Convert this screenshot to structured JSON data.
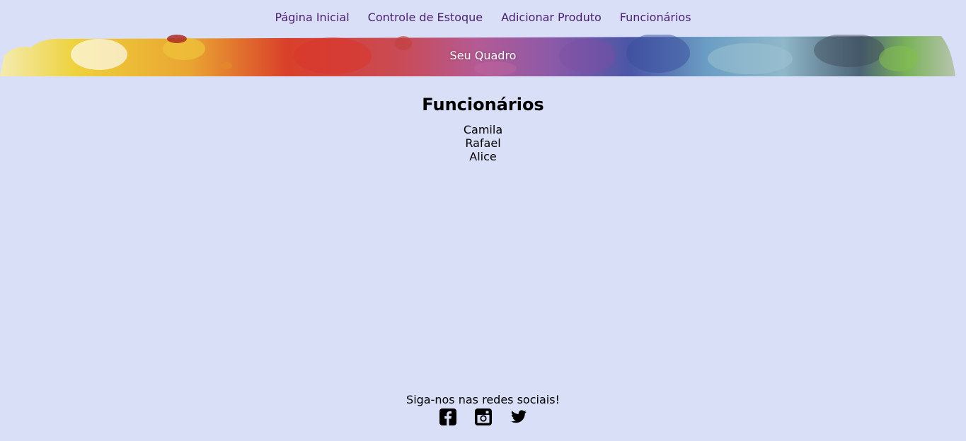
{
  "nav": {
    "items": [
      {
        "label": "Página Inicial"
      },
      {
        "label": "Controle de Estoque"
      },
      {
        "label": "Adicionar Produto"
      },
      {
        "label": "Funcionários"
      }
    ]
  },
  "banner": {
    "title": "Seu Quadro"
  },
  "main": {
    "heading": "Funcionários",
    "employees": [
      "Camila",
      "Rafael",
      "Alice"
    ]
  },
  "footer": {
    "text": "Siga-nos nas redes sociais!",
    "socials": [
      {
        "icon": "facebook-icon"
      },
      {
        "icon": "instagram-icon"
      },
      {
        "icon": "twitter-icon"
      }
    ]
  },
  "colors": {
    "background": "#d9dff7",
    "nav_link": "#4a1e6e",
    "banner_text": "#ffffff"
  }
}
